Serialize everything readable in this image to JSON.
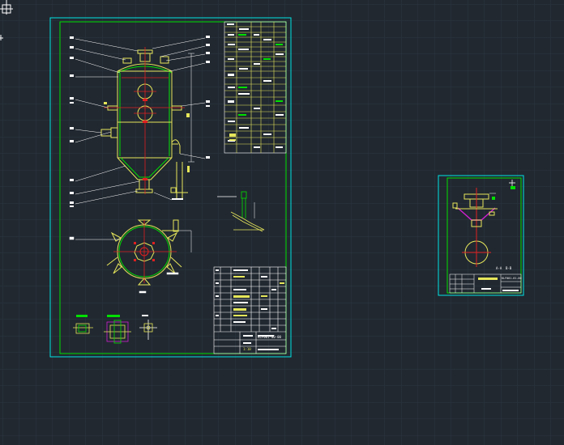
{
  "app": {
    "name": "CAD drawing viewport",
    "background": "#212830",
    "grid_color": "#2c3540",
    "colors": {
      "frame": "#00e5e5",
      "border": "#00e000",
      "line": "#e6e65a",
      "red": "#e02020",
      "magenta": "#d020d0",
      "white": "#ffffff",
      "green": "#00d000"
    }
  },
  "sheet_main": {
    "title_block": {
      "drawing_no": "KLF001-00-00",
      "scale": "1:10",
      "sheet": "1/2"
    },
    "bom_header": "明细表",
    "tech_header": "技术特性表",
    "nozzle_header": "管口表"
  },
  "sheet_small": {
    "title_block": {
      "drawing_no": "KLF001-01-00",
      "part_name": "锥底组件"
    },
    "view_labels": [
      "A-A",
      "B-B"
    ]
  },
  "icons": [
    "crosshair-icon",
    "ucs-icon"
  ]
}
